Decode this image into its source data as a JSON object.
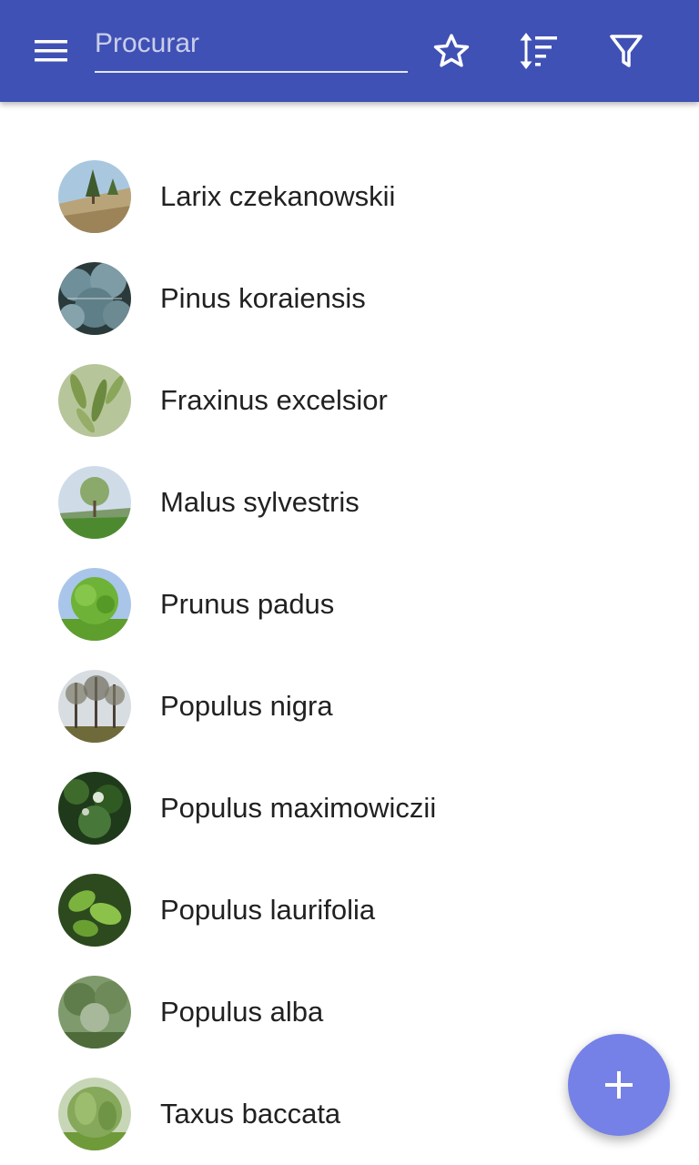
{
  "toolbar": {
    "background": "#3f51b5",
    "menu_icon": "hamburger-menu-icon",
    "search": {
      "value": "",
      "placeholder": "Procurar"
    },
    "favorites_icon": "star-outline-icon",
    "sort_icon": "sort-icon",
    "filter_icon": "filter-icon"
  },
  "plants": [
    {
      "name": "Larix czekanowskii",
      "thumb": "tree-photo"
    },
    {
      "name": "Pinus koraiensis",
      "thumb": "tree-photo"
    },
    {
      "name": "Fraxinus excelsior",
      "thumb": "tree-photo"
    },
    {
      "name": "Malus sylvestris",
      "thumb": "tree-photo"
    },
    {
      "name": "Prunus padus",
      "thumb": "tree-photo"
    },
    {
      "name": "Populus nigra",
      "thumb": "tree-photo"
    },
    {
      "name": "Populus maximowiczii",
      "thumb": "tree-photo"
    },
    {
      "name": "Populus laurifolia",
      "thumb": "tree-photo"
    },
    {
      "name": "Populus alba",
      "thumb": "tree-photo"
    },
    {
      "name": "Taxus baccata",
      "thumb": "tree-photo"
    }
  ],
  "fab": {
    "icon": "plus-icon",
    "color": "#7581e6"
  }
}
